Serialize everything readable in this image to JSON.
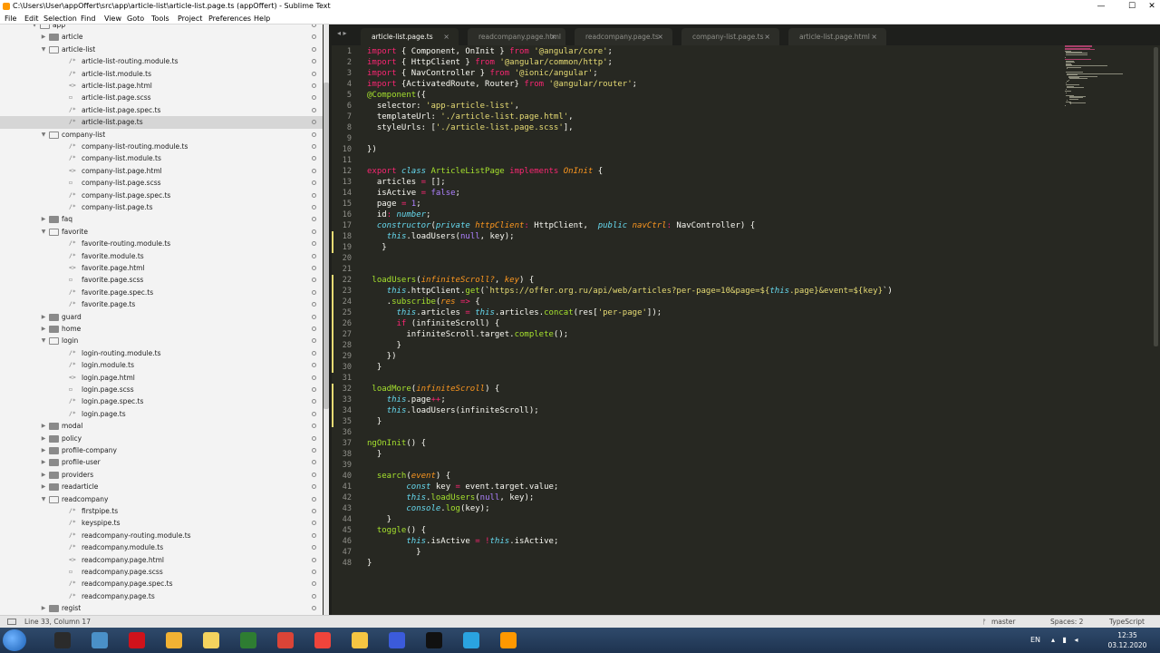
{
  "window": {
    "title": "C:\\Users\\User\\appOffert\\src\\app\\article-list\\article-list.page.ts (appOffert) - Sublime Text",
    "min_glyph": "—",
    "max_glyph": "☐",
    "close_glyph": "✕"
  },
  "menu": [
    "File",
    "Edit",
    "Selection",
    "Find",
    "View",
    "Goto",
    "Tools",
    "Project",
    "Preferences",
    "Help"
  ],
  "sidebar": {
    "rows": [
      {
        "label": "app",
        "type": "folder-open",
        "depth": 0
      },
      {
        "label": "article",
        "type": "folder",
        "depth": 1
      },
      {
        "label": "article-list",
        "type": "folder-open",
        "depth": 1
      },
      {
        "label": "article-list-routing.module.ts",
        "type": "file",
        "glyph": "/*",
        "depth": 2
      },
      {
        "label": "article-list.module.ts",
        "type": "file",
        "glyph": "/*",
        "depth": 2
      },
      {
        "label": "article-list.page.html",
        "type": "file",
        "glyph": "<>",
        "depth": 2
      },
      {
        "label": "article-list.page.scss",
        "type": "file",
        "glyph": "▭",
        "depth": 2
      },
      {
        "label": "article-list.page.spec.ts",
        "type": "file",
        "glyph": "/*",
        "depth": 2
      },
      {
        "label": "article-list.page.ts",
        "type": "file",
        "glyph": "/*",
        "depth": 2,
        "selected": true
      },
      {
        "label": "company-list",
        "type": "folder-open",
        "depth": 1
      },
      {
        "label": "company-list-routing.module.ts",
        "type": "file",
        "glyph": "/*",
        "depth": 2
      },
      {
        "label": "company-list.module.ts",
        "type": "file",
        "glyph": "/*",
        "depth": 2
      },
      {
        "label": "company-list.page.html",
        "type": "file",
        "glyph": "<>",
        "depth": 2
      },
      {
        "label": "company-list.page.scss",
        "type": "file",
        "glyph": "▭",
        "depth": 2
      },
      {
        "label": "company-list.page.spec.ts",
        "type": "file",
        "glyph": "/*",
        "depth": 2
      },
      {
        "label": "company-list.page.ts",
        "type": "file",
        "glyph": "/*",
        "depth": 2
      },
      {
        "label": "faq",
        "type": "folder",
        "depth": 1
      },
      {
        "label": "favorite",
        "type": "folder-open",
        "depth": 1
      },
      {
        "label": "favorite-routing.module.ts",
        "type": "file",
        "glyph": "/*",
        "depth": 2
      },
      {
        "label": "favorite.module.ts",
        "type": "file",
        "glyph": "/*",
        "depth": 2
      },
      {
        "label": "favorite.page.html",
        "type": "file",
        "glyph": "<>",
        "depth": 2
      },
      {
        "label": "favorite.page.scss",
        "type": "file",
        "glyph": "▭",
        "depth": 2
      },
      {
        "label": "favorite.page.spec.ts",
        "type": "file",
        "glyph": "/*",
        "depth": 2
      },
      {
        "label": "favorite.page.ts",
        "type": "file",
        "glyph": "/*",
        "depth": 2
      },
      {
        "label": "guard",
        "type": "folder",
        "depth": 1
      },
      {
        "label": "home",
        "type": "folder",
        "depth": 1
      },
      {
        "label": "login",
        "type": "folder-open",
        "depth": 1
      },
      {
        "label": "login-routing.module.ts",
        "type": "file",
        "glyph": "/*",
        "depth": 2
      },
      {
        "label": "login.module.ts",
        "type": "file",
        "glyph": "/*",
        "depth": 2
      },
      {
        "label": "login.page.html",
        "type": "file",
        "glyph": "<>",
        "depth": 2
      },
      {
        "label": "login.page.scss",
        "type": "file",
        "glyph": "▭",
        "depth": 2
      },
      {
        "label": "login.page.spec.ts",
        "type": "file",
        "glyph": "/*",
        "depth": 2
      },
      {
        "label": "login.page.ts",
        "type": "file",
        "glyph": "/*",
        "depth": 2
      },
      {
        "label": "modal",
        "type": "folder",
        "depth": 1
      },
      {
        "label": "policy",
        "type": "folder",
        "depth": 1
      },
      {
        "label": "profile-company",
        "type": "folder",
        "depth": 1
      },
      {
        "label": "profile-user",
        "type": "folder",
        "depth": 1
      },
      {
        "label": "providers",
        "type": "folder",
        "depth": 1
      },
      {
        "label": "readarticle",
        "type": "folder",
        "depth": 1
      },
      {
        "label": "readcompany",
        "type": "folder-open",
        "depth": 1
      },
      {
        "label": "firstpipe.ts",
        "type": "file",
        "glyph": "/*",
        "depth": 2
      },
      {
        "label": "keyspipe.ts",
        "type": "file",
        "glyph": "/*",
        "depth": 2
      },
      {
        "label": "readcompany-routing.module.ts",
        "type": "file",
        "glyph": "/*",
        "depth": 2
      },
      {
        "label": "readcompany.module.ts",
        "type": "file",
        "glyph": "/*",
        "depth": 2
      },
      {
        "label": "readcompany.page.html",
        "type": "file",
        "glyph": "<>",
        "depth": 2
      },
      {
        "label": "readcompany.page.scss",
        "type": "file",
        "glyph": "▭",
        "depth": 2
      },
      {
        "label": "readcompany.page.spec.ts",
        "type": "file",
        "glyph": "/*",
        "depth": 2
      },
      {
        "label": "readcompany.page.ts",
        "type": "file",
        "glyph": "/*",
        "depth": 2
      },
      {
        "label": "regist",
        "type": "folder",
        "depth": 1
      }
    ]
  },
  "tabs": [
    {
      "label": "article-list.page.ts",
      "active": true
    },
    {
      "label": "readcompany.page.html",
      "active": false
    },
    {
      "label": "readcompany.page.ts",
      "active": false
    },
    {
      "label": "company-list.page.ts",
      "active": false
    },
    {
      "label": "article-list.page.html",
      "active": false
    }
  ],
  "tab_nav": "◂ ▸",
  "tab_close_glyph": "×",
  "editor": {
    "modified_lines": [
      18,
      19,
      22,
      23,
      24,
      25,
      26,
      27,
      28,
      29,
      30,
      32,
      33,
      34,
      35
    ],
    "lines": [
      [
        [
          "k",
          "import"
        ],
        [
          "t",
          " { Component, OnInit } "
        ],
        [
          "k",
          "from"
        ],
        [
          "t",
          " "
        ],
        [
          "s",
          "'@angular/core'"
        ],
        [
          "t",
          ";"
        ]
      ],
      [
        [
          "k",
          "import"
        ],
        [
          "t",
          " { HttpClient } "
        ],
        [
          "k",
          "from"
        ],
        [
          "t",
          " "
        ],
        [
          "s",
          "'@angular/common/http'"
        ],
        [
          "t",
          ";"
        ]
      ],
      [
        [
          "k",
          "import"
        ],
        [
          "t",
          " { NavController } "
        ],
        [
          "k",
          "from"
        ],
        [
          "t",
          " "
        ],
        [
          "s",
          "'@ionic/angular'"
        ],
        [
          "t",
          ";"
        ]
      ],
      [
        [
          "k",
          "import"
        ],
        [
          "t",
          " {ActivatedRoute, Router} "
        ],
        [
          "k",
          "from"
        ],
        [
          "t",
          " "
        ],
        [
          "s",
          "'@angular/router'"
        ],
        [
          "t",
          ";"
        ]
      ],
      [
        [
          "f",
          "@Component"
        ],
        [
          "t",
          "({"
        ]
      ],
      [
        [
          "t",
          "  selector: "
        ],
        [
          "s",
          "'app-article-list'"
        ],
        [
          "t",
          ","
        ]
      ],
      [
        [
          "t",
          "  templateUrl: "
        ],
        [
          "s",
          "'./article-list.page.html'"
        ],
        [
          "t",
          ","
        ]
      ],
      [
        [
          "t",
          "  styleUrls: ["
        ],
        [
          "s",
          "'./article-list.page.scss'"
        ],
        [
          "t",
          "],"
        ]
      ],
      [
        [
          "t",
          ""
        ]
      ],
      [
        [
          "t",
          "})"
        ]
      ],
      [
        [
          "t",
          ""
        ]
      ],
      [
        [
          "k",
          "export"
        ],
        [
          "t",
          " "
        ],
        [
          "c",
          "class"
        ],
        [
          "t",
          " "
        ],
        [
          "f",
          "ArticleListPage"
        ],
        [
          "t",
          " "
        ],
        [
          "k",
          "implements"
        ],
        [
          "t",
          " "
        ],
        [
          "p",
          "OnInit"
        ],
        [
          "t",
          " {"
        ]
      ],
      [
        [
          "t",
          "  articles "
        ],
        [
          "k",
          "="
        ],
        [
          "t",
          " [];"
        ]
      ],
      [
        [
          "t",
          "  isActive "
        ],
        [
          "k",
          "="
        ],
        [
          "t",
          " "
        ],
        [
          "n",
          "false"
        ],
        [
          "t",
          ";"
        ]
      ],
      [
        [
          "t",
          "  page "
        ],
        [
          "k",
          "="
        ],
        [
          "t",
          " "
        ],
        [
          "n",
          "1"
        ],
        [
          "t",
          ";"
        ]
      ],
      [
        [
          "t",
          "  id"
        ],
        [
          "k",
          ":"
        ],
        [
          "t",
          " "
        ],
        [
          "c",
          "number"
        ],
        [
          "t",
          ";"
        ]
      ],
      [
        [
          "t",
          "  "
        ],
        [
          "c",
          "constructor"
        ],
        [
          "t",
          "("
        ],
        [
          "c",
          "private"
        ],
        [
          "t",
          " "
        ],
        [
          "p",
          "httpClient"
        ],
        [
          "k",
          ":"
        ],
        [
          "t",
          " HttpClient,  "
        ],
        [
          "c",
          "public"
        ],
        [
          "t",
          " "
        ],
        [
          "p",
          "navCtrl"
        ],
        [
          "k",
          ":"
        ],
        [
          "t",
          " NavController) {"
        ]
      ],
      [
        [
          "t",
          "    "
        ],
        [
          "c",
          "this"
        ],
        [
          "t",
          ".loadUsers("
        ],
        [
          "n",
          "null"
        ],
        [
          "t",
          ", key);"
        ]
      ],
      [
        [
          "t",
          "   }"
        ]
      ],
      [
        [
          "t",
          ""
        ]
      ],
      [
        [
          "t",
          ""
        ]
      ],
      [
        [
          "t",
          " "
        ],
        [
          "f",
          "loadUsers"
        ],
        [
          "t",
          "("
        ],
        [
          "p",
          "infiniteScroll?"
        ],
        [
          "t",
          ", "
        ],
        [
          "p",
          "key"
        ],
        [
          "t",
          ") {"
        ]
      ],
      [
        [
          "t",
          "    "
        ],
        [
          "c",
          "this"
        ],
        [
          "t",
          ".httpClient."
        ],
        [
          "f",
          "get"
        ],
        [
          "t",
          "(`"
        ],
        [
          "s",
          "https://offer.org.ru/api/web/articles?per-page=10&page=${"
        ],
        [
          "c",
          "this"
        ],
        [
          "s",
          ".page}&event=${key}"
        ],
        [
          "t",
          "`)"
        ]
      ],
      [
        [
          "t",
          "    ."
        ],
        [
          "f",
          "subscribe"
        ],
        [
          "t",
          "("
        ],
        [
          "p",
          "res"
        ],
        [
          "t",
          " "
        ],
        [
          "k",
          "=>"
        ],
        [
          "t",
          " {"
        ]
      ],
      [
        [
          "t",
          "      "
        ],
        [
          "c",
          "this"
        ],
        [
          "t",
          ".articles "
        ],
        [
          "k",
          "="
        ],
        [
          "t",
          " "
        ],
        [
          "c",
          "this"
        ],
        [
          "t",
          ".articles."
        ],
        [
          "f",
          "concat"
        ],
        [
          "t",
          "(res["
        ],
        [
          "s",
          "'per-page'"
        ],
        [
          "t",
          "]);"
        ]
      ],
      [
        [
          "t",
          "      "
        ],
        [
          "k",
          "if"
        ],
        [
          "t",
          " (infiniteScroll) {"
        ]
      ],
      [
        [
          "t",
          "        infiniteScroll.target."
        ],
        [
          "f",
          "complete"
        ],
        [
          "t",
          "();"
        ]
      ],
      [
        [
          "t",
          "      }"
        ]
      ],
      [
        [
          "t",
          "    })"
        ]
      ],
      [
        [
          "t",
          "  }"
        ]
      ],
      [
        [
          "t",
          ""
        ]
      ],
      [
        [
          "t",
          " "
        ],
        [
          "f",
          "loadMore"
        ],
        [
          "t",
          "("
        ],
        [
          "p",
          "infiniteScroll"
        ],
        [
          "t",
          ") {"
        ]
      ],
      [
        [
          "t",
          "    "
        ],
        [
          "c",
          "this"
        ],
        [
          "t",
          ".page"
        ],
        [
          "k",
          "++"
        ],
        [
          "t",
          ";"
        ]
      ],
      [
        [
          "t",
          "    "
        ],
        [
          "c",
          "this"
        ],
        [
          "t",
          ".loadUsers(infiniteScroll);"
        ]
      ],
      [
        [
          "t",
          "  }"
        ]
      ],
      [
        [
          "t",
          ""
        ]
      ],
      [
        [
          "f",
          "ngOnInit"
        ],
        [
          "t",
          "() {"
        ]
      ],
      [
        [
          "t",
          "  }"
        ]
      ],
      [
        [
          "t",
          ""
        ]
      ],
      [
        [
          "t",
          "  "
        ],
        [
          "f",
          "search"
        ],
        [
          "t",
          "("
        ],
        [
          "p",
          "event"
        ],
        [
          "t",
          ") {"
        ]
      ],
      [
        [
          "t",
          "        "
        ],
        [
          "c",
          "const"
        ],
        [
          "t",
          " key "
        ],
        [
          "k",
          "="
        ],
        [
          "t",
          " event.target.value;"
        ]
      ],
      [
        [
          "t",
          "        "
        ],
        [
          "c",
          "this"
        ],
        [
          "t",
          "."
        ],
        [
          "f",
          "loadUsers"
        ],
        [
          "t",
          "("
        ],
        [
          "n",
          "null"
        ],
        [
          "t",
          ", key);"
        ]
      ],
      [
        [
          "t",
          "        "
        ],
        [
          "c",
          "console"
        ],
        [
          "t",
          "."
        ],
        [
          "f",
          "log"
        ],
        [
          "t",
          "(key);"
        ]
      ],
      [
        [
          "t",
          "    }"
        ]
      ],
      [
        [
          "t",
          "  "
        ],
        [
          "f",
          "toggle"
        ],
        [
          "t",
          "() {"
        ]
      ],
      [
        [
          "t",
          "        "
        ],
        [
          "c",
          "this"
        ],
        [
          "t",
          ".isActive "
        ],
        [
          "k",
          "="
        ],
        [
          "t",
          " "
        ],
        [
          "k",
          "!"
        ],
        [
          "c",
          "this"
        ],
        [
          "t",
          ".isActive;"
        ]
      ],
      [
        [
          "t",
          "          }"
        ]
      ],
      [
        [
          "t",
          "}"
        ]
      ]
    ]
  },
  "status": {
    "position": "Line 33, Column 17",
    "branch": "master",
    "spaces": "Spaces: 2",
    "syntax": "TypeScript"
  },
  "taskbar": {
    "lang": "EN",
    "time": "12:35",
    "date": "03.12.2020",
    "icons": [
      {
        "name": "nox-icon",
        "color": "#2b2b2b"
      },
      {
        "name": "files-icon",
        "color": "#4a90c8"
      },
      {
        "name": "opera-icon",
        "color": "#d0121b"
      },
      {
        "name": "chrome-dev-icon",
        "color": "#f2b233"
      },
      {
        "name": "notes-icon",
        "color": "#f4d35e"
      },
      {
        "name": "spreadsheet-icon",
        "color": "#2e7d32"
      },
      {
        "name": "chrome-icon",
        "color": "#db4437"
      },
      {
        "name": "anydesk-icon",
        "color": "#ef443b"
      },
      {
        "name": "folder-icon",
        "color": "#f5c542"
      },
      {
        "name": "save-icon",
        "color": "#3b5bdb"
      },
      {
        "name": "terminal-icon",
        "color": "#111111"
      },
      {
        "name": "telegram-icon",
        "color": "#2aa3e0"
      },
      {
        "name": "sublime-icon",
        "color": "#ff9800"
      }
    ]
  },
  "colors": {
    "editor_bg": "#272822",
    "keyword": "#f92672",
    "string": "#e6db74",
    "function": "#a6e22e",
    "storage": "#66d9ef",
    "param": "#fd971f",
    "constant": "#ae81ff"
  }
}
